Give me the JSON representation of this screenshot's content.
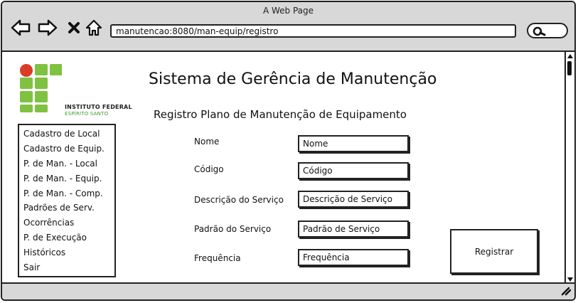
{
  "window": {
    "title": "A Web Page"
  },
  "browser": {
    "url": "manutencao:8080/man-equip/registro"
  },
  "logo": {
    "line1": "INSTITUTO FEDERAL",
    "line2": "ESPÍRITO SANTO"
  },
  "header": {
    "app_title": "Sistema de Gerência de Manutenção"
  },
  "form": {
    "title": "Registro Plano de Manutenção de Equipamento",
    "fields": [
      {
        "label": "Nome",
        "placeholder": "Nome"
      },
      {
        "label": "Código",
        "placeholder": "Código"
      },
      {
        "label": "Descrição do Serviço",
        "placeholder": "Descrição de Serviço"
      },
      {
        "label": "Padrão do Serviço",
        "placeholder": "Padrão de Serviço"
      },
      {
        "label": "Frequência",
        "placeholder": "Frequência"
      }
    ],
    "submit_label": "Registrar"
  },
  "sidebar": {
    "items": [
      {
        "label": "Cadastro de Local"
      },
      {
        "label": "Cadastro de Equip."
      },
      {
        "label": "P. de Man. - Local"
      },
      {
        "label": "P. de Man. - Equip."
      },
      {
        "label": "P. de Man. - Comp."
      },
      {
        "label": "Padrões de Serv."
      },
      {
        "label": "Ocorrências"
      },
      {
        "label": "P. de Execução"
      },
      {
        "label": "Históricos"
      },
      {
        "label": "Sair"
      }
    ]
  },
  "icons": {
    "back": "arrow-left-icon",
    "forward": "arrow-right-icon",
    "stop": "close-icon",
    "home": "home-icon",
    "search": "search-icon",
    "resize": "resize-grip-icon"
  },
  "colors": {
    "logo_red": "#dc3b26",
    "logo_green": "#7fc241",
    "chrome": "#d8d8d8"
  }
}
